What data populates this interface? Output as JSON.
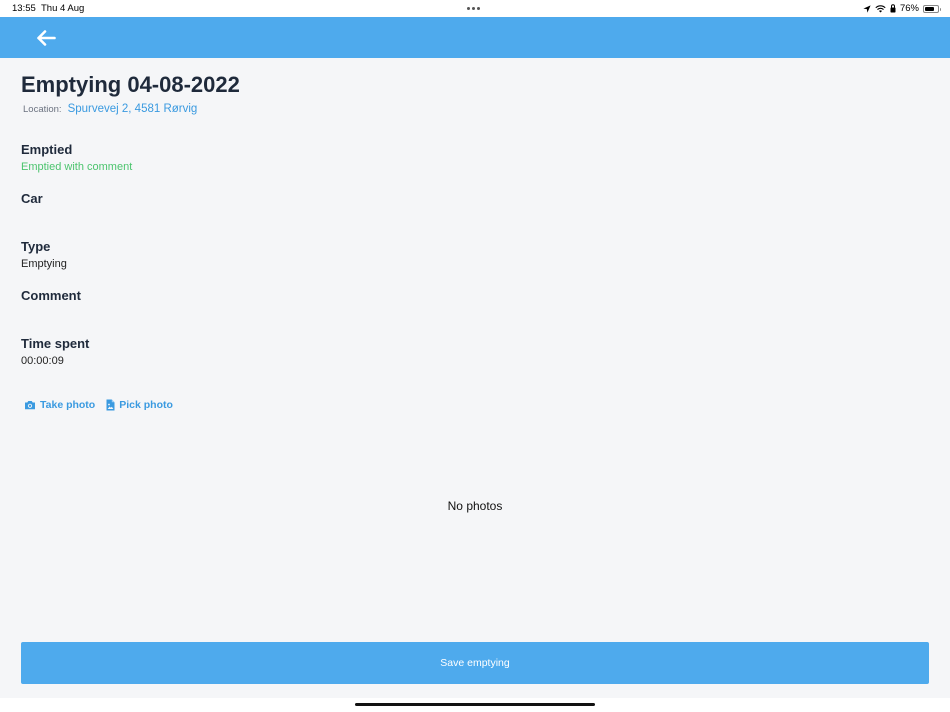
{
  "status_bar": {
    "time": "13:55",
    "date": "Thu 4 Aug",
    "battery_percent": "76%",
    "battery_level": 0.76,
    "icons": [
      "location-arrow-icon",
      "wifi-icon",
      "lock-rotation-icon",
      "battery-icon"
    ]
  },
  "header": {
    "back_icon": "arrow-left-icon",
    "color": "#4eaaed"
  },
  "page": {
    "title": "Emptying 04-08-2022",
    "location_label": "Location:",
    "location_value": "Spurvevej 2, 4581 Rørvig"
  },
  "fields": {
    "emptied": {
      "label": "Emptied",
      "value": "Emptied with comment",
      "value_color": "#4cc46e"
    },
    "car": {
      "label": "Car",
      "value": ""
    },
    "type": {
      "label": "Type",
      "value": "Emptying"
    },
    "comment": {
      "label": "Comment",
      "value": ""
    },
    "time_spent": {
      "label": "Time spent",
      "value": "00:00:09"
    }
  },
  "photos": {
    "take_photo": {
      "label": "Take photo",
      "icon": "camera-icon"
    },
    "pick_photo": {
      "label": "Pick photo",
      "icon": "file-image-icon"
    },
    "empty_text": "No photos"
  },
  "actions": {
    "save_label": "Save emptying"
  },
  "colors": {
    "accent": "#4eaaed",
    "link": "#3a9ae0",
    "background": "#f5f6f8",
    "success": "#4cc46e"
  }
}
